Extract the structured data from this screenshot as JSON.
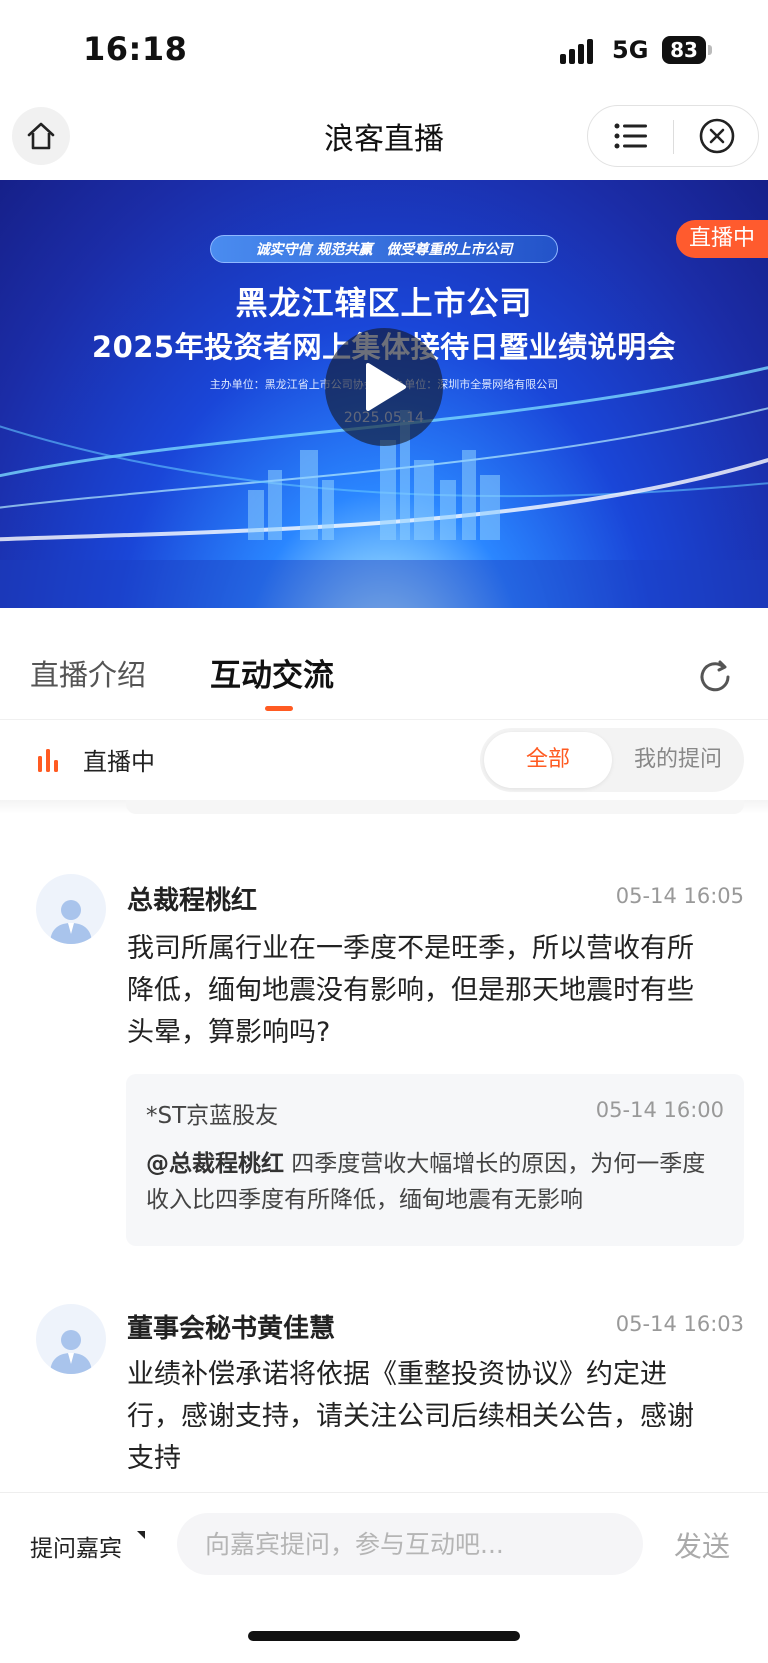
{
  "status_bar": {
    "time": "16:18",
    "network": "5G",
    "battery": "83"
  },
  "nav": {
    "title": "浪客直播"
  },
  "banner": {
    "slogan_left": "诚实守信  规范共赢",
    "slogan_right": "做受尊重的上市公司",
    "title_line1": "黑龙江辖区上市公司",
    "title_line2": "2025年投资者网上集体接待日暨业绩说明会",
    "organizers": "主办单位：黑龙江省上市公司协会        协办单位：深圳市全景网络有限公司",
    "date": "2025.05.14",
    "live_badge": "直播中"
  },
  "tabs": [
    {
      "label": "直播介绍",
      "active": false
    },
    {
      "label": "互动交流",
      "active": true
    }
  ],
  "filter": {
    "live_label": "直播中",
    "all_label": "全部",
    "mine_label": "我的提问"
  },
  "comments": [
    {
      "name": "总裁程桃红",
      "time": "05-14 16:05",
      "text": "我司所属行业在一季度不是旺季，所以营收有所降低，缅甸地震没有影响，但是那天地震时有些头晕，算影响吗?",
      "quote": {
        "name": "*ST京蓝股友",
        "time": "05-14 16:00",
        "mention": "@总裁程桃红",
        "text": " 四季度营收大幅增长的原因，为何一季度收入比四季度有所降低，缅甸地震有无影响"
      }
    },
    {
      "name": "董事会秘书黄佳慧",
      "time": "05-14 16:03",
      "text": "业绩补偿承诺将依据《重整投资协议》约定进行，感谢支持，请关注公司后续相关公告，感谢支持"
    }
  ],
  "input_bar": {
    "ask_guest": "提问嘉宾",
    "placeholder": "向嘉宾提问，参与互动吧...",
    "send": "发送"
  },
  "colors": {
    "accent": "#ff5b22",
    "live_badge": "#ff5b2e"
  }
}
